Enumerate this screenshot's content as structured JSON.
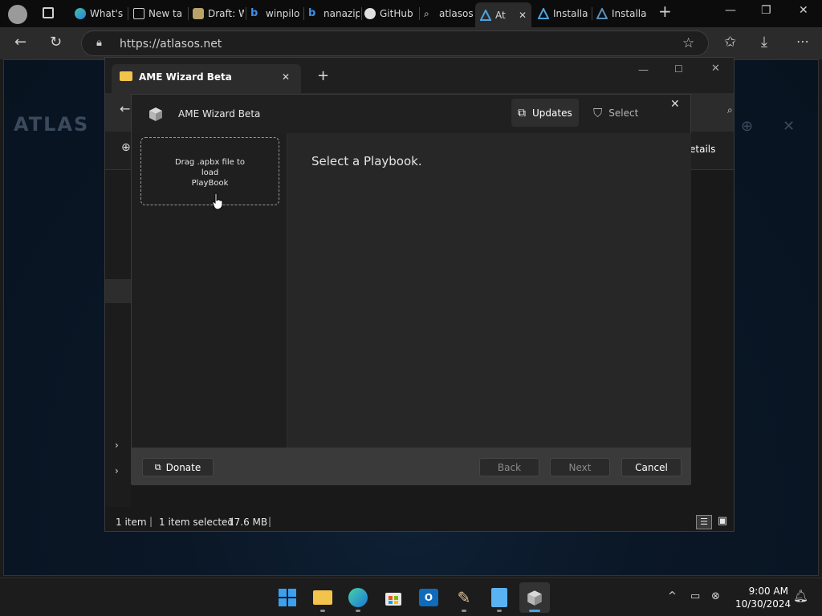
{
  "browser": {
    "tabs": [
      {
        "label": "What's",
        "icon": "edge-icon",
        "active": false
      },
      {
        "label": "New ta",
        "icon": "newtab-icon",
        "active": false
      },
      {
        "label": "Draft: W",
        "icon": "draft-icon",
        "active": false
      },
      {
        "label": "winpilo",
        "icon": "bing-icon",
        "active": false
      },
      {
        "label": "nanazip",
        "icon": "bing-icon",
        "active": false
      },
      {
        "label": "GitHub",
        "icon": "github-icon",
        "active": false
      },
      {
        "label": "atlasos",
        "icon": "search-icon",
        "active": false
      },
      {
        "label": "At",
        "icon": "atlas-icon",
        "active": true
      },
      {
        "label": "Installa",
        "icon": "atlas-icon",
        "active": false
      },
      {
        "label": "Installa",
        "icon": "atlas-icon",
        "active": false
      }
    ],
    "url": "https://atlasos.net"
  },
  "page": {
    "bg_brand_text": "ATLAS"
  },
  "explorer": {
    "tab_title": "AME Wizard Beta",
    "details_label": "etails",
    "status": {
      "items": "1 item",
      "selected": "1 item selected",
      "size": "17.6 MB"
    }
  },
  "dialog": {
    "title": "AME Wizard Beta",
    "updates_label": "Updates",
    "select_label": "Select",
    "dropzone_lines": [
      "Drag .apbx file to",
      "load",
      "PlayBook"
    ],
    "placeholder": "Select a Playbook.",
    "footer": {
      "donate": "Donate",
      "back": "Back",
      "next": "Next",
      "cancel": "Cancel"
    }
  },
  "taskbar": {
    "time": "9:00 AM",
    "date": "10/30/2024"
  },
  "colors": {
    "accent": "#4aa3df",
    "dialog_bg": "#202020",
    "footer_bg": "#3a3a3a"
  }
}
